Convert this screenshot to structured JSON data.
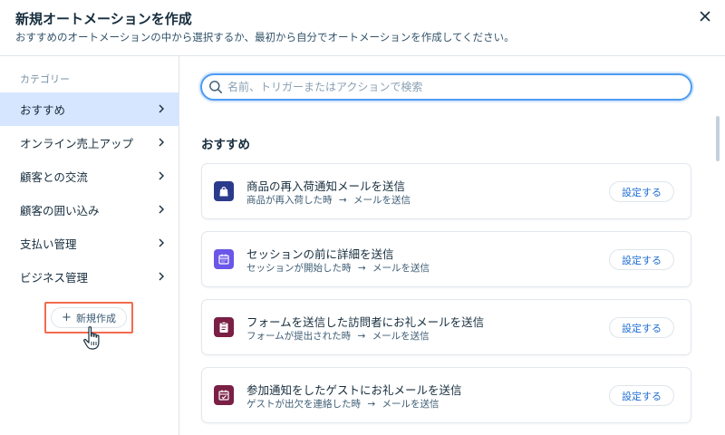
{
  "header": {
    "title": "新規オートメーションを作成",
    "subtitle": "おすすめのオートメーションの中から選択するか、最初から自分でオートメーションを作成してください。"
  },
  "sidebar": {
    "heading": "カテゴリー",
    "items": [
      {
        "label": "おすすめ",
        "active": true
      },
      {
        "label": "オンライン売上アップ"
      },
      {
        "label": "顧客との交流"
      },
      {
        "label": "顧客の囲い込み"
      },
      {
        "label": "支払い管理"
      },
      {
        "label": "ビジネス管理"
      }
    ],
    "new_button_label": "新規作成"
  },
  "search": {
    "placeholder": "名前、トリガーまたはアクションで検索",
    "value": ""
  },
  "main": {
    "section_title": "おすすめ",
    "cards": [
      {
        "title": "商品の再入荷通知メールを送信",
        "trigger": "商品が再入荷した時",
        "arrow": "→",
        "action": "メールを送信",
        "button": "設定する",
        "icon": "shopping-bag-icon",
        "icon_color": "#2b3b8c"
      },
      {
        "title": "セッションの前に詳細を送信",
        "trigger": "セッションが開始した時",
        "arrow": "→",
        "action": "メールを送信",
        "button": "設定する",
        "icon": "calendar-icon",
        "icon_color": "#6a56e8"
      },
      {
        "title": "フォームを送信した訪問者にお礼メールを送信",
        "trigger": "フォームが提出された時",
        "arrow": "→",
        "action": "メールを送信",
        "button": "設定する",
        "icon": "clipboard-icon",
        "icon_color": "#7a1f45"
      },
      {
        "title": "参加通知をしたゲストにお礼メールを送信",
        "trigger": "ゲストが出欠を連絡した時",
        "arrow": "→",
        "action": "メールを送信",
        "button": "設定する",
        "icon": "calendar-check-icon",
        "icon_color": "#7a1f45"
      }
    ]
  },
  "colors": {
    "accent": "#4d9bf2",
    "active_bg": "#d6e6fe",
    "highlight_frame": "#f26b4f",
    "link": "#1f6ed4"
  }
}
